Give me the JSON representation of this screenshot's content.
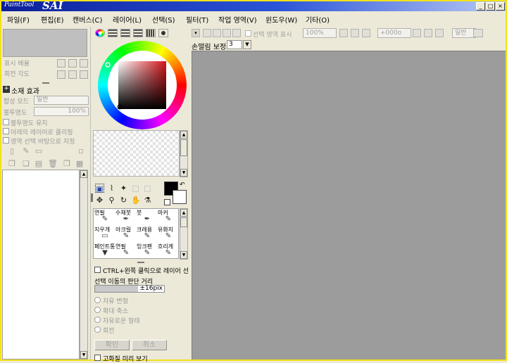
{
  "title_bar": {
    "logo_small": "PaintTool",
    "logo_big": "SAI",
    "minimize": "_",
    "maximize": "□",
    "close": "×"
  },
  "menu": {
    "items": [
      "파일(F)",
      "편집(E)",
      "캔버스(C)",
      "레이어(L)",
      "선택(S)",
      "필터(T)",
      "작업 영역(V)",
      "윈도우(W)",
      "기타(O)"
    ]
  },
  "left_panel": {
    "zoom_label": "표시 배율",
    "angle_label": "회전 각도",
    "texture_heading": "소재 효과",
    "blend_mode_label": "합성 모드",
    "blend_mode_value": "일반",
    "opacity_label": "불투명도",
    "opacity_value": "100%",
    "checkboxes": [
      "불투명도 유지",
      "아래의 레이어로 클리핑",
      "영역 선택 바탕으로 지정"
    ]
  },
  "color_panel": {
    "stabilizer_hint": ""
  },
  "tools": {
    "brushes": [
      {
        "name": "연필",
        "icon": "✎"
      },
      {
        "name": "수채붓",
        "icon": "✒"
      },
      {
        "name": "붓",
        "icon": "✒"
      },
      {
        "name": "마커",
        "icon": "✎"
      },
      {
        "name": "지우개",
        "icon": "▭"
      },
      {
        "name": "아크릴",
        "icon": "✎"
      },
      {
        "name": "크레용",
        "icon": "✎"
      },
      {
        "name": "유화지",
        "icon": "✎"
      },
      {
        "name": "페인트통",
        "icon": "▼"
      },
      {
        "name": "연필",
        "icon": "✎"
      },
      {
        "name": "잉크펜",
        "icon": "✎"
      },
      {
        "name": "흐리게",
        "icon": "✎"
      }
    ],
    "ctrl_option": "CTRL+왼쪽 클릭으로 레이어 선",
    "select_distance_label": "선택 이동의 판단 거리",
    "select_distance_value": "±16pix",
    "transform_options": [
      "자유 변형",
      "확대 축소",
      "자유로운 형태",
      "회전"
    ],
    "ok_label": "확인",
    "cancel_label": "취소",
    "hq_preview_label": "고화질 미리 보기"
  },
  "toolbar": {
    "selection_area_label": "선택 영역 표시",
    "zoom_value": "100%",
    "rotation_value": "+000o",
    "blend_value": "일반"
  },
  "stabilizer": {
    "label": "손떨림 보정",
    "value": "3"
  },
  "colors": {
    "title_start": "#0b1f9a",
    "canvas_bg": "#9c9c9c",
    "window_border": "#f2e21a",
    "selected_hue": "#d3141a"
  }
}
